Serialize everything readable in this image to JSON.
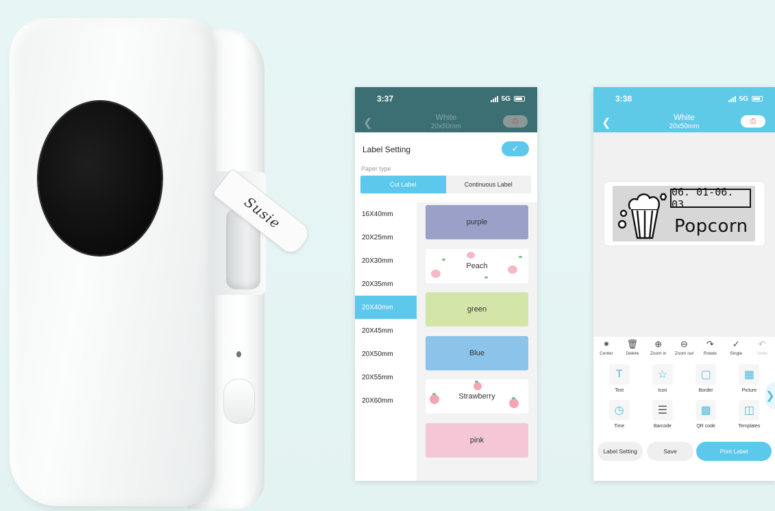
{
  "printer": {
    "label_text": "Susie"
  },
  "phone1": {
    "status": {
      "time": "3:37",
      "network": "5G"
    },
    "navbar": {
      "title": "White",
      "subtitle": "20x50mm"
    },
    "sheet": {
      "title": "Label Setting",
      "paper_type_label": "Paper type",
      "paper_types": [
        {
          "label": "Cut Label",
          "selected": true
        },
        {
          "label": "Continuous Label",
          "selected": false
        }
      ],
      "sizes": [
        "16X40mm",
        "20X25mm",
        "20X30mm",
        "20X35mm",
        "20X40mm",
        "20X45mm",
        "20X50mm",
        "20X55mm",
        "20X60mm"
      ],
      "selected_size": "20X40mm",
      "swatches": [
        {
          "label": "purple",
          "color": "#9aa0c8"
        },
        {
          "label": "Peach",
          "color": "#ffffff",
          "pattern": "peach"
        },
        {
          "label": "green",
          "color": "#d3e5a8"
        },
        {
          "label": "Blue",
          "color": "#8cc3ea"
        },
        {
          "label": "Strawberry",
          "color": "#ffffff",
          "pattern": "strawberry"
        },
        {
          "label": "pink",
          "color": "#f4c6d6"
        }
      ]
    }
  },
  "phone2": {
    "status": {
      "time": "3:38",
      "network": "5G"
    },
    "navbar": {
      "title": "White",
      "subtitle": "20x50mm"
    },
    "label": {
      "date": "06. 01-06. 03",
      "text": "Popcorn"
    },
    "toolbar": [
      {
        "label": "Center",
        "icon": "align-center-icon"
      },
      {
        "label": "Delete",
        "icon": "trash-icon"
      },
      {
        "label": "Zoom in",
        "icon": "zoom-in-icon"
      },
      {
        "label": "Zoom out",
        "icon": "zoom-out-icon"
      },
      {
        "label": "Rotate",
        "icon": "rotate-icon"
      },
      {
        "label": "Single",
        "icon": "check-icon"
      },
      {
        "label": "Undo",
        "icon": "undo-icon"
      }
    ],
    "tools": [
      {
        "label": "Text",
        "icon": "text-icon"
      },
      {
        "label": "Icon",
        "icon": "star-icon"
      },
      {
        "label": "Border",
        "icon": "border-icon"
      },
      {
        "label": "Picture",
        "icon": "picture-icon"
      },
      {
        "label": "Time",
        "icon": "clock-icon"
      },
      {
        "label": "Barcode",
        "icon": "barcode-icon"
      },
      {
        "label": "QR code",
        "icon": "qr-code-icon"
      },
      {
        "label": "Templates",
        "icon": "templates-icon"
      }
    ],
    "buttons": {
      "label_setting": "Label Setting",
      "save": "Save",
      "print": "Print Label"
    },
    "accent": "#5cc8ec"
  }
}
